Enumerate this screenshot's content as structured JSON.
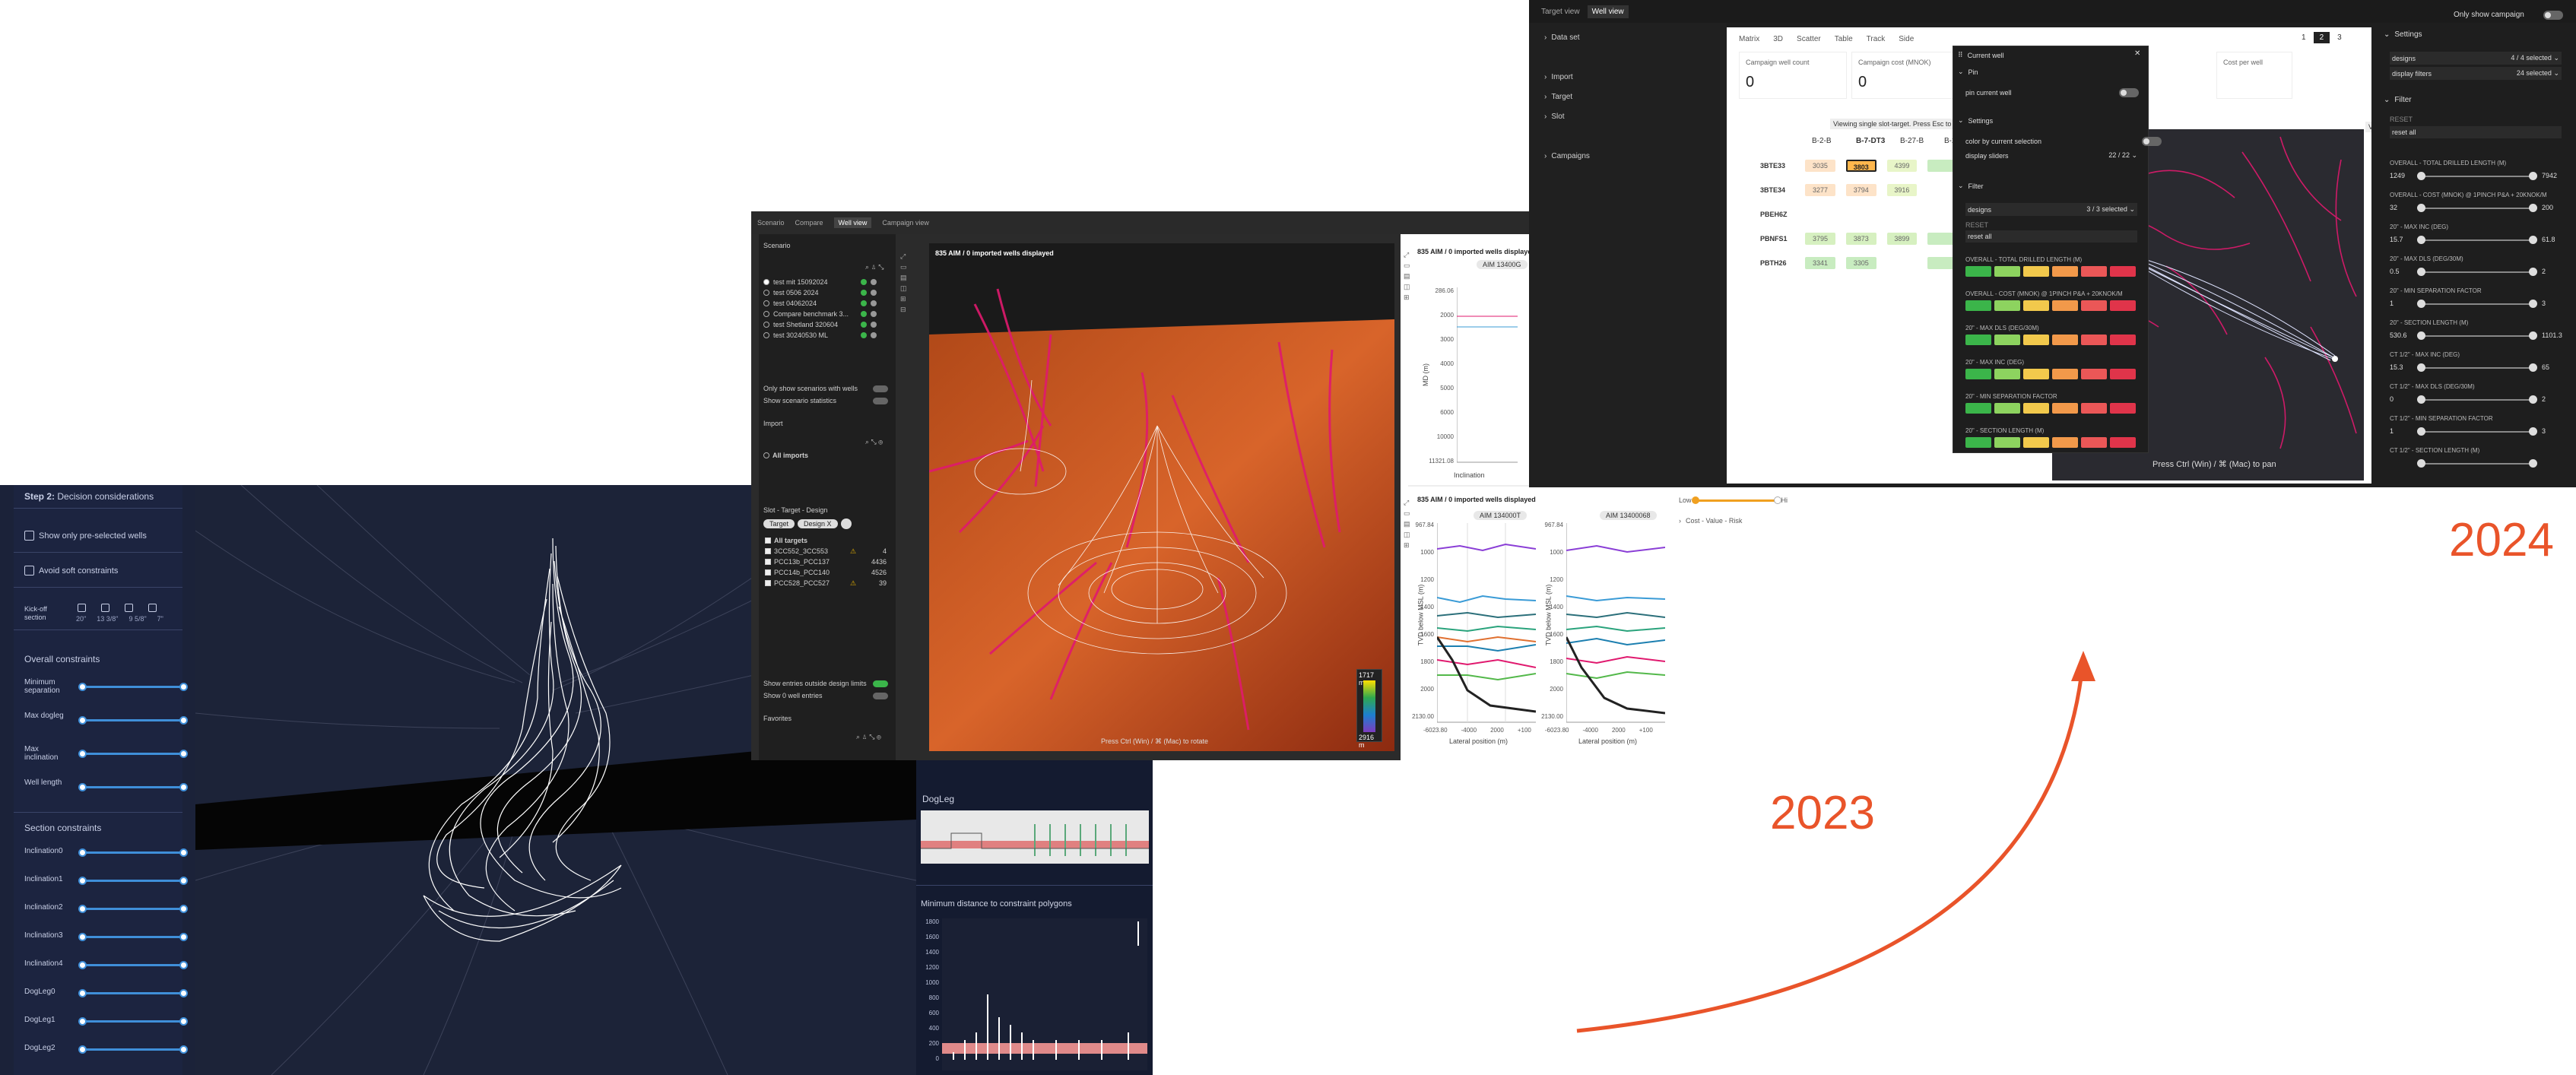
{
  "w1": {
    "step_prefix": "Step 2:",
    "step_title": "Decision considerations",
    "cb_preselected": "Show only pre-selected wells",
    "cb_soft": "Avoid soft constraints",
    "kickoff_label": "Kick-off section",
    "kickoff_opts": [
      "20\"",
      "13 3/8\"",
      "9 5/8\"",
      "7\""
    ],
    "overall_header": "Overall constraints",
    "overall_sliders": [
      "Minimum separation",
      "Max dogleg",
      "Max inclination",
      "Well length"
    ],
    "section_header": "Section constraints",
    "section_sliders": [
      "Inclination0",
      "Inclination1",
      "Inclination2",
      "Inclination3",
      "Inclination4",
      "DogLeg0",
      "DogLeg1",
      "DogLeg2"
    ],
    "dogleg_title": "DogLeg",
    "mindist_title": "Minimum distance to constraint polygons",
    "mindist_yticks": [
      "1800",
      "1600",
      "1400",
      "1200",
      "1000",
      "800",
      "600",
      "400",
      "200",
      "0"
    ]
  },
  "w2": {
    "top_tabs": [
      "Scenario",
      "Compare",
      "Well view",
      "Campaign view"
    ],
    "scenario_header": "Scenario",
    "scenarios": [
      "test mit 15092024",
      "test 0506 2024",
      "test 04062024",
      "Compare benchmark 3...",
      "test Shetland 320604",
      "test 30240530 ML"
    ],
    "only_with_wells": "Only show scenarios with wells",
    "show_stats": "Show scenario statistics",
    "import_header": "Import",
    "all_imports": "All imports",
    "slot_header": "Slot - Target - Design",
    "target_btn": "Target",
    "design_btn": "Design X",
    "all_targets": "All targets",
    "targets": [
      {
        "name": "3CC552_3CC553",
        "count": "4"
      },
      {
        "name": "PCC13b_PCC137",
        "count": "4436"
      },
      {
        "name": "PCC14b_PCC140",
        "count": "4526"
      },
      {
        "name": "PCC528_PCC527",
        "count": "39"
      }
    ],
    "show_outside": "Show entries outside design limits",
    "show_0": "Show 0 well entries",
    "fav_header": "Favorites",
    "view_title": "835 AIM / 0 imported wells displayed",
    "depth_top": "1717 m",
    "depth_bot": "2916 m",
    "rotate_hint": "Press Ctrl (Win) / ⌘ (Mac) to rotate",
    "plot_title": "835 AIM / 0 imported wells displayed",
    "plot_chip": "AIM 13400G",
    "plot_yticks": [
      "286.06",
      "2000",
      "3000",
      "4000",
      "5000",
      "6000",
      "10000",
      "11321.08"
    ],
    "plot_ylabel": "MD (m)",
    "plot_xlabel": "Inclination",
    "bottom_title": "835 AIM / 0 imported wells displayed",
    "chipA": "AIM 134000T",
    "chipB": "AIM 13400068",
    "tvd_label": "TVD below MSL (m)",
    "tvd_yticks": [
      "967.84",
      "1000",
      "1200",
      "1400",
      "1600",
      "1800",
      "2000",
      "2130.00"
    ],
    "lat_xticks": [
      "-6023.80",
      "-4000",
      "2000",
      "+100"
    ],
    "lat_xlabel": "Lateral position (m)",
    "cost_label": "Cost - Value - Risk"
  },
  "year2023": "2023",
  "year2024": "2024",
  "w3": {
    "tabs": [
      "Target view",
      "Well view"
    ],
    "only_campaign": "Only show campaign",
    "left_items": [
      "Data set",
      "Import",
      "Target",
      "Slot",
      "Campaigns"
    ],
    "main_tabs": [
      "Matrix",
      "3D",
      "Scatter",
      "Table",
      "Track",
      "Side"
    ],
    "pages": [
      "1",
      "2",
      "3"
    ],
    "kpis": [
      {
        "label": "Campaign well count",
        "value": "0"
      },
      {
        "label": "Campaign cost (MNOK)",
        "value": "0"
      },
      {
        "label": "Cost per well",
        "value": ""
      }
    ],
    "hint": "Viewing single slot-target. Press Esc to close",
    "col_heads": [
      "B-2-B",
      "B-7-DT3",
      "B-27-B",
      "B-29"
    ],
    "rows": [
      {
        "name": "3BTE33",
        "vals": [
          "3035",
          "3803",
          "4399",
          ""
        ]
      },
      {
        "name": "3BTE34",
        "vals": [
          "3277",
          "3794",
          "3916",
          ""
        ]
      },
      {
        "name": "PBEH6Z",
        "vals": [
          "",
          "",
          "",
          ""
        ]
      },
      {
        "name": "PBNFS1",
        "vals": [
          "3795",
          "3873",
          "3899",
          ""
        ]
      },
      {
        "name": "PBTH26",
        "vals": [
          "3341",
          "3305",
          "",
          ""
        ]
      }
    ],
    "cw_title": "Current well",
    "cw_pin_header": "Pin",
    "cw_pin_label": "pin current well",
    "cw_settings": "Settings",
    "cw_color": "color by current selection",
    "cw_display": "display sliders",
    "cw_display_val": "22 / 22",
    "cw_filter": "Filter",
    "cw_designs": "designs",
    "cw_designs_val": "3 / 3 selected",
    "cw_reset_lbl": "RESET",
    "cw_reset": "reset all",
    "cw_metrics": [
      "OVERALL - TOTAL DRILLED LENGTH (M)",
      "OVERALL - COST (MNOK) @ 1PINCH P&A + 20KNOK/M",
      "20\" - MAX DLS (DEG/30M)",
      "20\" - MAX INC (DEG)",
      "20\" - MIN SEPARATION FACTOR",
      "20\" - SECTION LENGTH (M)"
    ],
    "pan_hint": "Press Ctrl (Win) / ⌘ (Mac) to pan",
    "rp_settings": "Settings",
    "rp_designs": "designs",
    "rp_designs_val": "4 / 4 selected",
    "rp_filters": "display filters",
    "rp_filters_val": "24 selected",
    "rp_filter": "Filter",
    "rp_reset_lbl": "RESET",
    "rp_reset": "reset all",
    "rp_sliders": [
      {
        "label": "OVERALL - TOTAL DRILLED LENGTH (M)",
        "min": "1249",
        "max": "7942"
      },
      {
        "label": "OVERALL - COST (MNOK) @ 1PINCH P&A + 20KNOK/M",
        "min": "32",
        "max": "200"
      },
      {
        "label": "20\" - MAX INC (DEG)",
        "min": "15.7",
        "max": "61.8"
      },
      {
        "label": "20\" - MAX DLS (DEG/30M)",
        "min": "0.5",
        "max": "2"
      },
      {
        "label": "20\" - MIN SEPARATION FACTOR",
        "min": "1",
        "max": "3"
      },
      {
        "label": "20\" - SECTION LENGTH (M)",
        "min": "530.6",
        "max": "1101.3"
      },
      {
        "label": "CT 1/2\" - MAX INC (DEG)",
        "min": "15.3",
        "max": "65"
      },
      {
        "label": "CT 1/2\" - MAX DLS (DEG/30M)",
        "min": "0",
        "max": "2"
      },
      {
        "label": "CT 1/2\" - MIN SEPARATION FACTOR",
        "min": "1",
        "max": "3"
      },
      {
        "label": "CT 1/2\" - SECTION LENGTH (M)",
        "min": "",
        "max": ""
      }
    ],
    "zoom_left": "Low",
    "zoom_right": "Hi",
    "cost_row": "Cost - Value - Risk"
  },
  "colors": {
    "accent_orange": "#e9542a",
    "pink": "#e0196e",
    "blue": "#3f8fd9"
  }
}
